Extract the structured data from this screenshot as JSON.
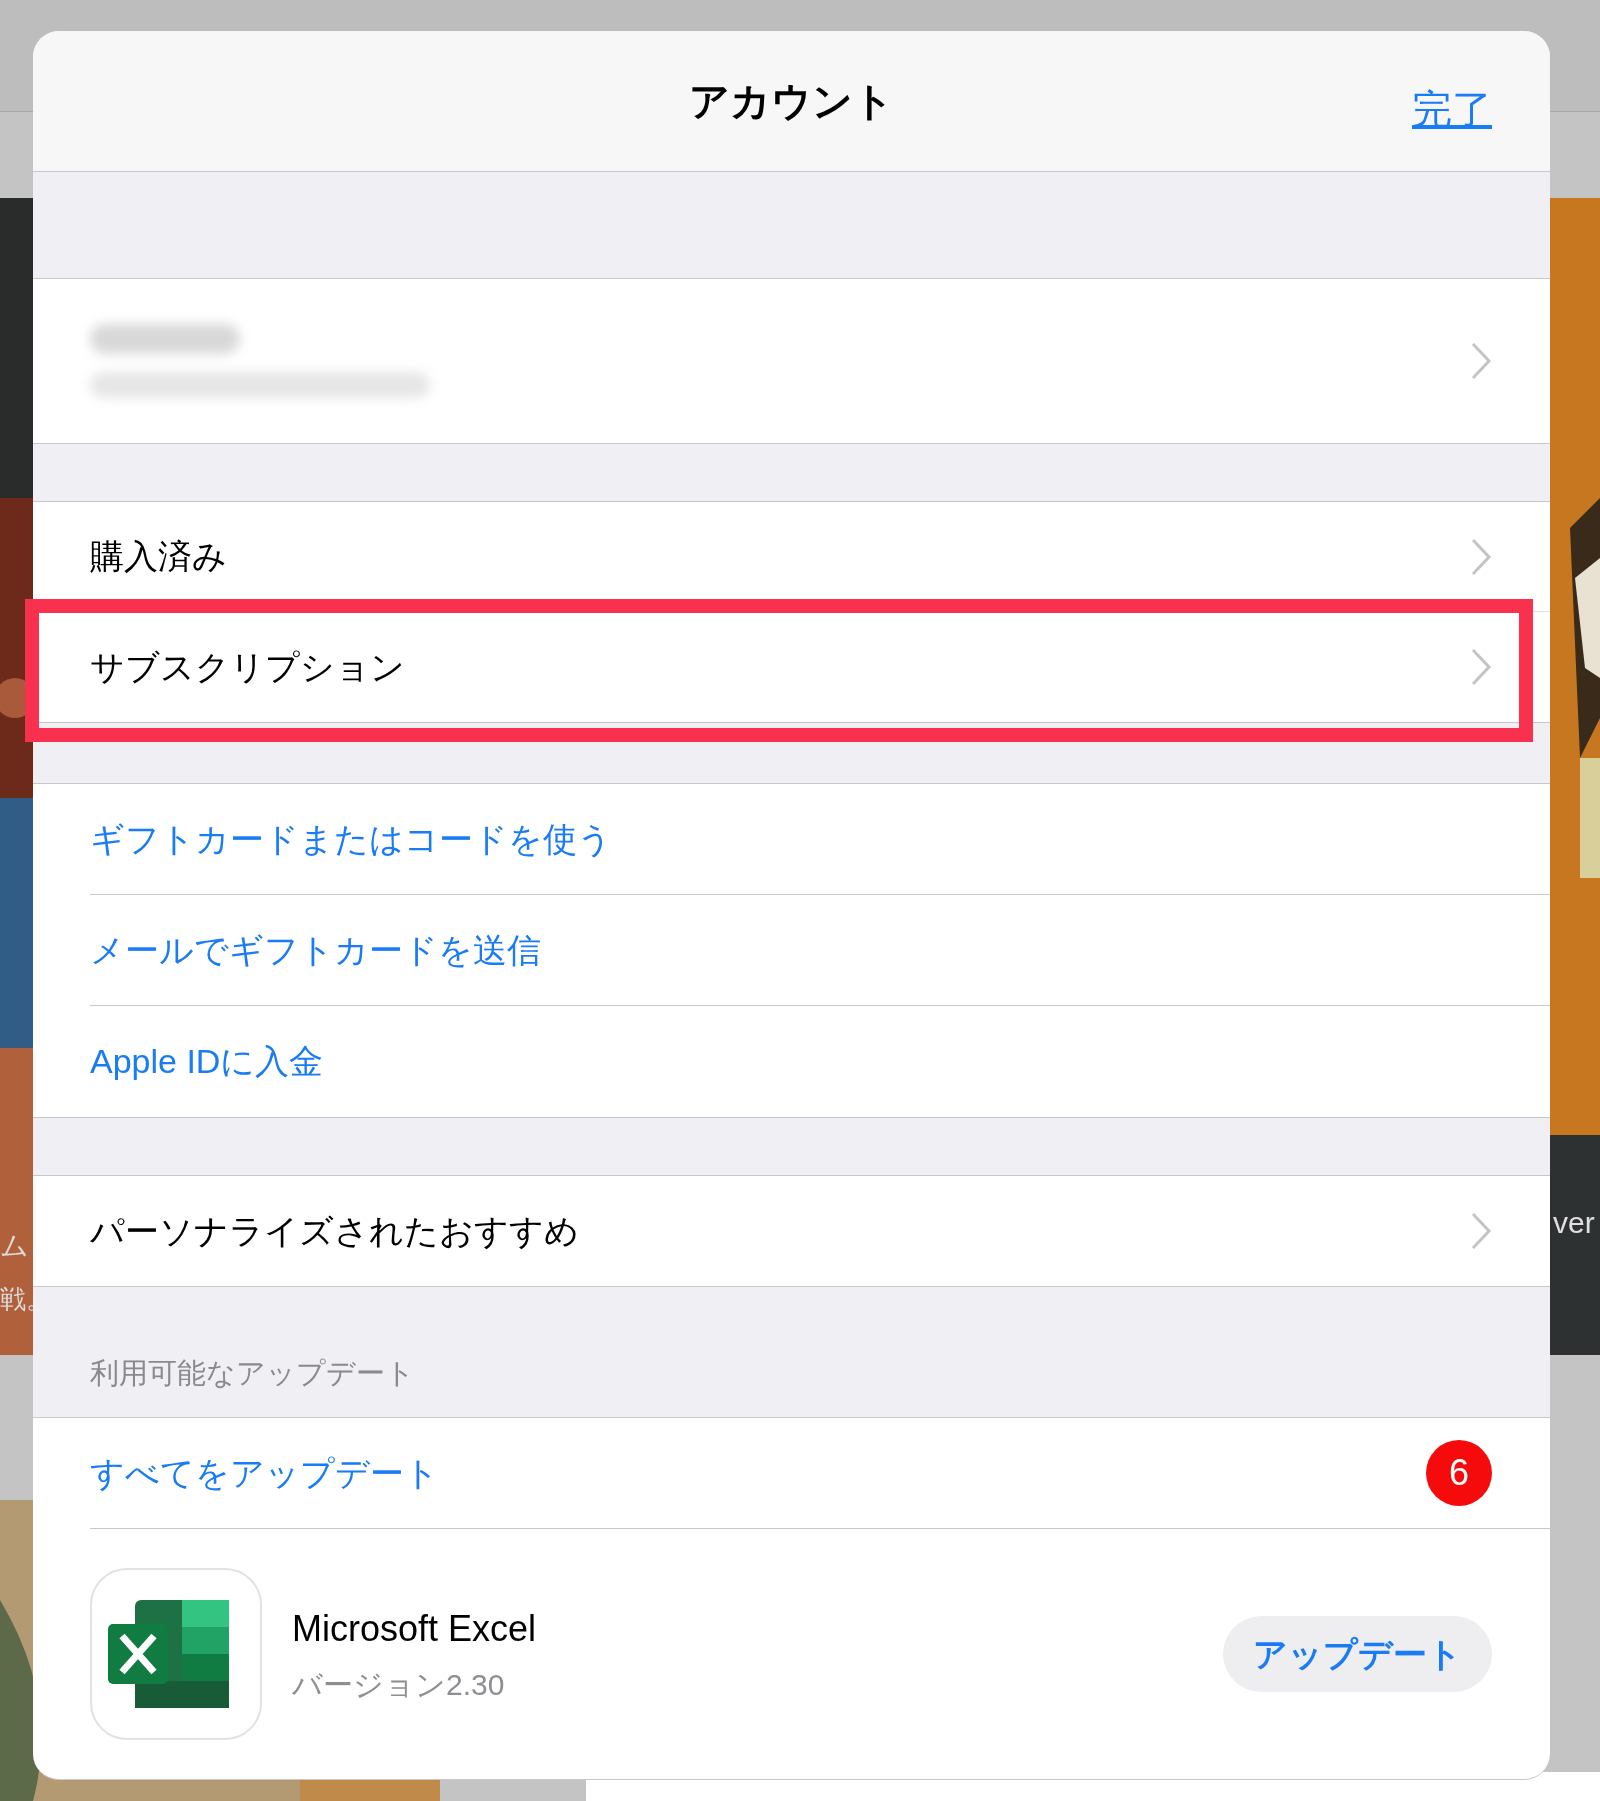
{
  "background": {
    "texts": [
      "ム",
      "戦。",
      "ver"
    ]
  },
  "header": {
    "title": "アカウント",
    "done": "完了"
  },
  "sections": [
    {
      "rows": [
        {
          "kind": "account"
        }
      ]
    },
    {
      "rows": [
        {
          "kind": "nav",
          "label": "購入済み",
          "highlighted": false
        },
        {
          "kind": "nav",
          "label": "サブスクリプション",
          "highlighted": true
        }
      ]
    },
    {
      "rows": [
        {
          "kind": "link",
          "label": "ギフトカードまたはコードを使う"
        },
        {
          "kind": "link",
          "label": "メールでギフトカードを送信"
        },
        {
          "kind": "link",
          "label": "Apple IDに入金"
        }
      ]
    },
    {
      "rows": [
        {
          "kind": "nav",
          "label": "パーソナライズされたおすすめ",
          "highlighted": false
        }
      ]
    },
    {
      "header": "利用可能なアップデート",
      "rows": [
        {
          "kind": "update_all",
          "label": "すべてをアップデート",
          "badge": "6"
        },
        {
          "kind": "app",
          "name": "Microsoft Excel",
          "version": "バージョン2.30",
          "button": "アップデート"
        }
      ]
    }
  ]
}
